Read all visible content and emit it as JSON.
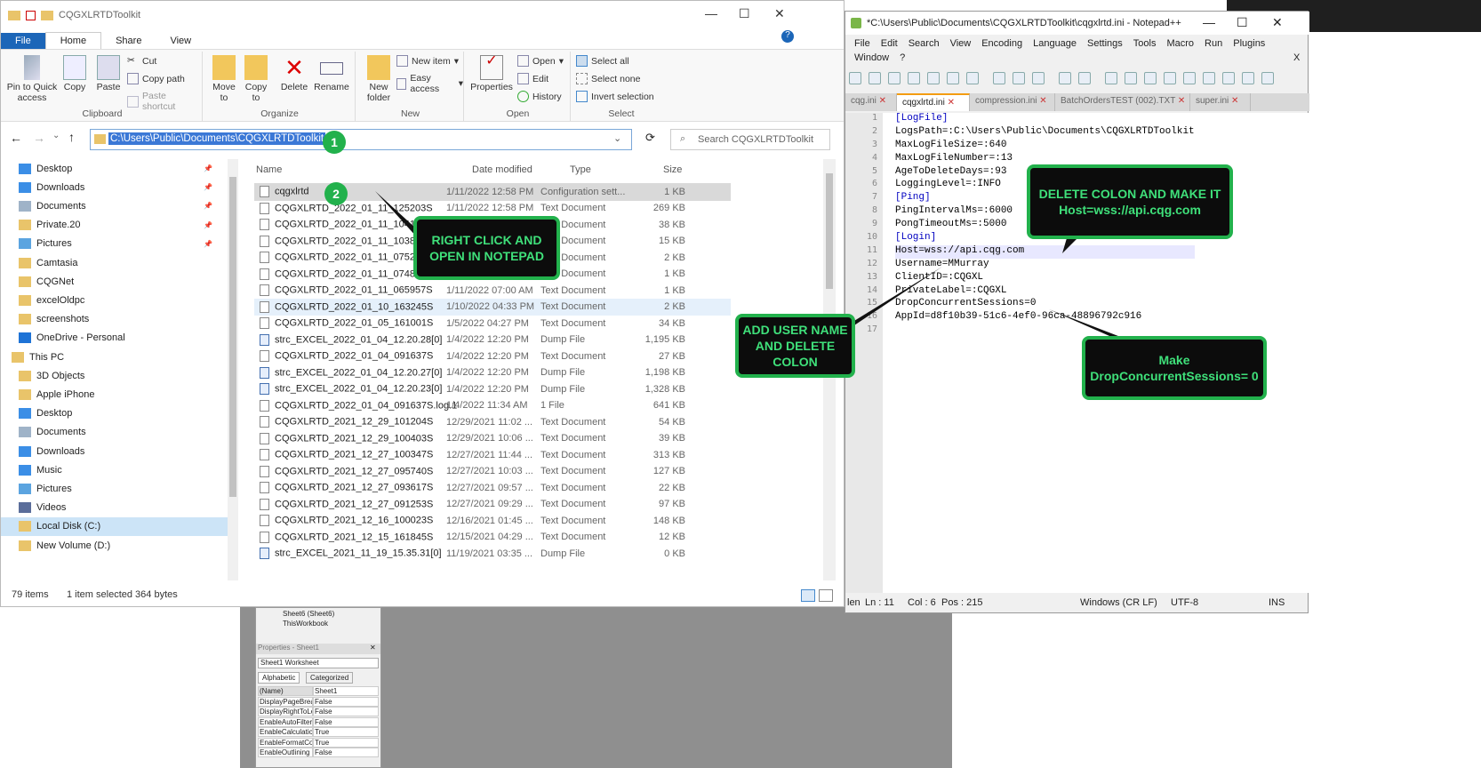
{
  "explorer": {
    "title": "CQGXLRTDToolkit",
    "tabs": [
      "File",
      "Home",
      "Share",
      "View"
    ],
    "ribbon": {
      "pin": "Pin to Quick access",
      "copy": "Copy",
      "paste": "Paste",
      "cut": "Cut",
      "copy_path": "Copy path",
      "paste_shortcut": "Paste shortcut",
      "move_to": "Move to",
      "copy_to": "Copy to",
      "delete": "Delete",
      "rename": "Rename",
      "new_folder": "New folder",
      "new_item": "New item",
      "easy_access": "Easy access",
      "properties": "Properties",
      "open": "Open",
      "edit": "Edit",
      "history": "History",
      "select_all": "Select all",
      "select_none": "Select none",
      "invert_selection": "Invert selection",
      "groups": [
        "Clipboard",
        "Organize",
        "New",
        "Open",
        "Select"
      ]
    },
    "address": "C:\\Users\\Public\\Documents\\CQGXLRTDToolkit",
    "search_placeholder": "Search CQGXLRTDToolkit",
    "nav": [
      "Desktop",
      "Downloads",
      "Documents",
      "Private.20",
      "Pictures",
      "Camtasia",
      "CQGNet",
      "excelOldpc",
      "screenshots",
      "OneDrive - Personal",
      "This PC",
      "3D Objects",
      "Apple iPhone",
      "Desktop",
      "Documents",
      "Downloads",
      "Music",
      "Pictures",
      "Videos",
      "Local Disk (C:)",
      "New Volume (D:)"
    ],
    "columns": [
      "Name",
      "Date modified",
      "Type",
      "Size"
    ],
    "files": [
      [
        "cqgxlrtd",
        "1/11/2022 12:58 PM",
        "Configuration sett...",
        "1 KB"
      ],
      [
        "CQGXLRTD_2022_01_11_125203S",
        "1/11/2022 12:58 PM",
        "Text Document",
        "269 KB"
      ],
      [
        "CQGXLRTD_2022_01_11_104107S",
        "1/11/2022 10:41 AM",
        "Text Document",
        "38 KB"
      ],
      [
        "CQGXLRTD_2022_01_11_103825S",
        "1/11/2022 10:38 AM",
        "Text Document",
        "15 KB"
      ],
      [
        "CQGXLRTD_2022_01_11_075212S",
        "1/11/2022 07:52 AM",
        "Text Document",
        "2 KB"
      ],
      [
        "CQGXLRTD_2022_01_11_074802S",
        "1/11/2022 07:50 AM",
        "Text Document",
        "1 KB"
      ],
      [
        "CQGXLRTD_2022_01_11_065957S",
        "1/11/2022 07:00 AM",
        "Text Document",
        "1 KB"
      ],
      [
        "CQGXLRTD_2022_01_10_163245S",
        "1/10/2022 04:33 PM",
        "Text Document",
        "2 KB"
      ],
      [
        "CQGXLRTD_2022_01_05_161001S",
        "1/5/2022 04:27 PM",
        "Text Document",
        "34 KB"
      ],
      [
        "strc_EXCEL_2022_01_04_12.20.28[0]",
        "1/4/2022 12:20 PM",
        "Dump File",
        "1,195 KB"
      ],
      [
        "CQGXLRTD_2022_01_04_091637S",
        "1/4/2022 12:20 PM",
        "Text Document",
        "27 KB"
      ],
      [
        "strc_EXCEL_2022_01_04_12.20.27[0]",
        "1/4/2022 12:20 PM",
        "Dump File",
        "1,198 KB"
      ],
      [
        "strc_EXCEL_2022_01_04_12.20.23[0]",
        "1/4/2022 12:20 PM",
        "Dump File",
        "1,328 KB"
      ],
      [
        "CQGXLRTD_2022_01_04_091637S.log.1",
        "1/4/2022 11:34 AM",
        "1 File",
        "641 KB"
      ],
      [
        "CQGXLRTD_2021_12_29_101204S",
        "12/29/2021 11:02 ...",
        "Text Document",
        "54 KB"
      ],
      [
        "CQGXLRTD_2021_12_29_100403S",
        "12/29/2021 10:06 ...",
        "Text Document",
        "39 KB"
      ],
      [
        "CQGXLRTD_2021_12_27_100347S",
        "12/27/2021 11:44 ...",
        "Text Document",
        "313 KB"
      ],
      [
        "CQGXLRTD_2021_12_27_095740S",
        "12/27/2021 10:03 ...",
        "Text Document",
        "127 KB"
      ],
      [
        "CQGXLRTD_2021_12_27_093617S",
        "12/27/2021 09:57 ...",
        "Text Document",
        "22 KB"
      ],
      [
        "CQGXLRTD_2021_12_27_091253S",
        "12/27/2021 09:29 ...",
        "Text Document",
        "97 KB"
      ],
      [
        "CQGXLRTD_2021_12_16_100023S",
        "12/16/2021 01:45 ...",
        "Text Document",
        "148 KB"
      ],
      [
        "CQGXLRTD_2021_12_15_161845S",
        "12/15/2021 04:29 ...",
        "Text Document",
        "12 KB"
      ],
      [
        "strc_EXCEL_2021_11_19_15.35.31[0]",
        "11/19/2021 03:35 ...",
        "Dump File",
        "0 KB"
      ]
    ],
    "status_items": "79 items",
    "status_selected": "1 item selected  364 bytes"
  },
  "vbe": {
    "tree": [
      "Sheet6 (Sheet6)",
      "ThisWorkbook"
    ],
    "props_title": "Properties - Sheet1",
    "object": "Sheet1 Worksheet",
    "tabs": [
      "Alphabetic",
      "Categorized"
    ],
    "rows": [
      [
        "(Name)",
        "Sheet1"
      ],
      [
        "DisplayPageBreak",
        "False"
      ],
      [
        "DisplayRightToLef",
        "False"
      ],
      [
        "EnableAutoFilter",
        "False"
      ],
      [
        "EnableCalculation",
        "True"
      ],
      [
        "EnableFormatCon",
        "True"
      ],
      [
        "EnableOutlining",
        "False"
      ]
    ]
  },
  "npp": {
    "title": "*C:\\Users\\Public\\Documents\\CQGXLRTDToolkit\\cqgxlrtd.ini - Notepad++",
    "menu": [
      "File",
      "Edit",
      "Search",
      "View",
      "Encoding",
      "Language",
      "Settings",
      "Tools",
      "Macro",
      "Run",
      "Plugins"
    ],
    "menu2": [
      "Window",
      "?"
    ],
    "tabs": [
      "cqg.ini",
      "cqgxlrtd.ini",
      "compression.ini",
      "BatchOrdersTEST (002).TXT",
      "super.ini"
    ],
    "lines": [
      "[LogFile]",
      "LogsPath=:C:\\Users\\Public\\Documents\\CQGXLRTDToolkit",
      "MaxLogFileSize=:640",
      "MaxLogFileNumber=:13",
      "AgeToDeleteDays=:93",
      "LoggingLevel=:INFO",
      "[Ping]",
      "PingIntervalMs=:6000",
      "PongTimeoutMs=:5000",
      "[Login]",
      "Host=wss://api.cqg.com",
      "Username=MMurray",
      "ClientID=:CQGXL",
      "PrivateLabel=:CQGXL",
      "DropConcurrentSessions=0",
      "AppId=d8f10b39-51c6-4ef0-96ca-48896792c916",
      ""
    ],
    "status": {
      "len": "len",
      "ln": "Ln : 11",
      "col": "Col : 6",
      "pos": "Pos : 215",
      "eol": "Windows (CR LF)",
      "enc": "UTF-8",
      "ins": "INS"
    }
  },
  "callouts": {
    "c1": "RIGHT CLICK AND OPEN IN NOTEPAD",
    "c2": "DELETE COLON AND MAKE IT Host=wss://api.cqg.com",
    "c3": "ADD USER NAME AND DELETE COLON",
    "c4": "Make DropConcurrentSessions= 0",
    "n1": "1",
    "n2": "2"
  }
}
